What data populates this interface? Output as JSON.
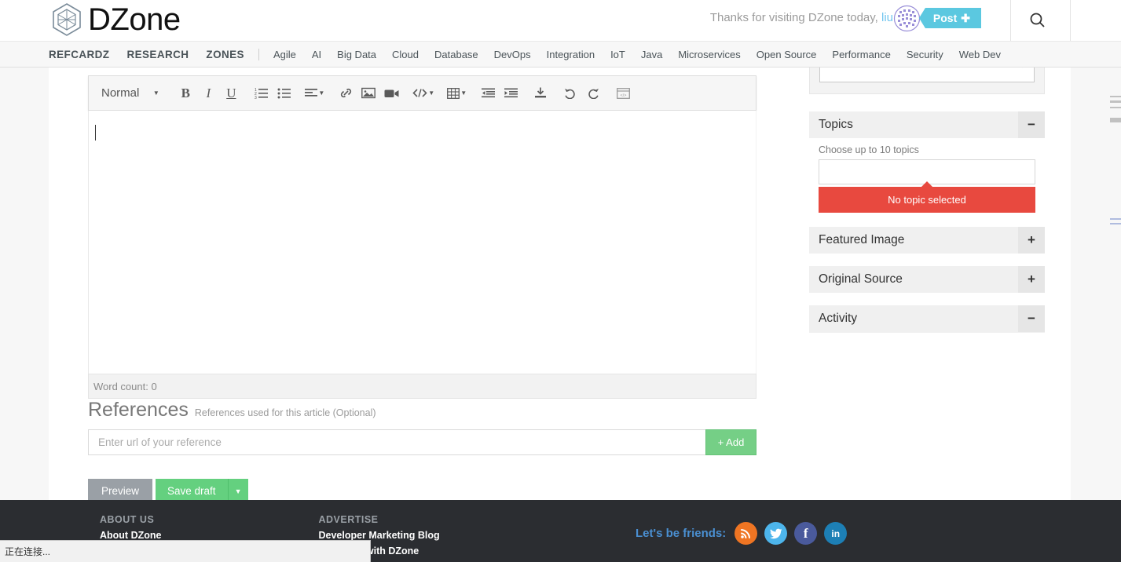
{
  "header": {
    "logo_text": "DZone",
    "greeting": "Thanks for visiting DZone today,",
    "username": "liu",
    "post_button": "Post",
    "post_button_plus": "✚",
    "search_icon": "search-icon"
  },
  "nav": {
    "primary": [
      "REFCARDZ",
      "RESEARCH",
      "ZONES"
    ],
    "zones": [
      "Agile",
      "AI",
      "Big Data",
      "Cloud",
      "Database",
      "DevOps",
      "Integration",
      "IoT",
      "Java",
      "Microservices",
      "Open Source",
      "Performance",
      "Security",
      "Web Dev"
    ]
  },
  "editor": {
    "format_label": "Normal",
    "toolbar": [
      {
        "name": "bold-button",
        "glyph": "B"
      },
      {
        "name": "italic-button",
        "glyph": "I"
      },
      {
        "name": "underline-button",
        "glyph": "U"
      },
      {
        "name": "ordered-list-button",
        "glyph": "list-ol-icon"
      },
      {
        "name": "bullet-list-button",
        "glyph": "list-ul-icon"
      },
      {
        "name": "align-button",
        "glyph": "align-left-icon"
      },
      {
        "name": "link-button",
        "glyph": "link-icon"
      },
      {
        "name": "image-button",
        "glyph": "image-icon"
      },
      {
        "name": "video-button",
        "glyph": "video-icon"
      },
      {
        "name": "code-button",
        "glyph": "code-icon"
      },
      {
        "name": "table-button",
        "glyph": "table-icon"
      },
      {
        "name": "outdent-button",
        "glyph": "outdent-icon"
      },
      {
        "name": "indent-button",
        "glyph": "indent-icon"
      },
      {
        "name": "import-button",
        "glyph": "download-icon"
      },
      {
        "name": "undo-button",
        "glyph": "undo-icon"
      },
      {
        "name": "redo-button",
        "glyph": "redo-icon"
      },
      {
        "name": "source-button",
        "glyph": "html-source-icon"
      }
    ],
    "body_text": "",
    "word_count": "Word count: 0"
  },
  "references": {
    "title": "References",
    "subtitle": "References used for this article (Optional)",
    "input_value": "",
    "input_placeholder": "Enter url of your reference",
    "add_label": "+ Add"
  },
  "actions": {
    "preview": "Preview",
    "save_draft": "Save draft",
    "save_caret": "▼"
  },
  "sidebar": {
    "select_value": "",
    "select_caret": "▼",
    "panels": [
      {
        "title": "Topics",
        "toggle": "−",
        "state": "expanded"
      },
      {
        "title": "Featured Image",
        "toggle": "+",
        "state": "collapsed"
      },
      {
        "title": "Original Source",
        "toggle": "+",
        "state": "collapsed"
      },
      {
        "title": "Activity",
        "toggle": "−",
        "state": "expanded"
      }
    ],
    "topics": {
      "hint": "Choose up to 10 topics",
      "input_value": "",
      "error": "No topic selected"
    }
  },
  "footer": {
    "columns": [
      {
        "heading": "ABOUT US",
        "links": [
          "About DZone"
        ]
      },
      {
        "heading": "ADVERTISE",
        "links": [
          "Developer Marketing Blog",
          "Advertise with DZone"
        ]
      }
    ],
    "friends_label": "Let's be friends:",
    "social": [
      {
        "name": "rss-icon",
        "glyph": "≈",
        "color": "#ef7523"
      },
      {
        "name": "twitter-icon",
        "glyph": "t",
        "color": "#4db5ec"
      },
      {
        "name": "facebook-icon",
        "glyph": "f",
        "color": "#4a5a9c"
      },
      {
        "name": "linkedin-icon",
        "glyph": "in",
        "color": "#1d7fb5"
      }
    ]
  },
  "browser": {
    "status_text": "正在连接..."
  },
  "colors": {
    "accent_green": "#64d07f",
    "post_cyan": "#5bc8e0",
    "error_red": "#e8493f",
    "footer_bg": "#2b2d31"
  }
}
